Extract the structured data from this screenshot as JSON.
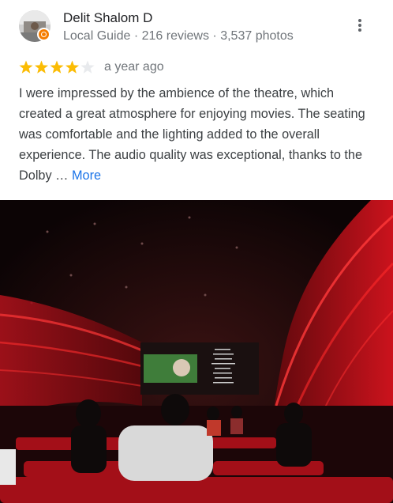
{
  "reviewer": {
    "name": "Delit Shalom D",
    "meta": "Local Guide · 216 reviews · 3,537 photos"
  },
  "review": {
    "rating": 4,
    "max_rating": 5,
    "date": "a year ago",
    "text": "I were impressed by the ambience of the theatre, which created a great atmosphere for enjoying movies. The seating was comfortable and the lighting added to the overall experience. The audio quality was exceptional, thanks to the Dolby …",
    "more_label": "More"
  },
  "colors": {
    "star_filled": "#fbbc04",
    "star_empty": "#e8eaed",
    "link": "#1a73e8",
    "badge": "#f57c00"
  },
  "icons": {
    "menu": "more-vert-icon",
    "badge": "local-guide-badge-icon"
  }
}
